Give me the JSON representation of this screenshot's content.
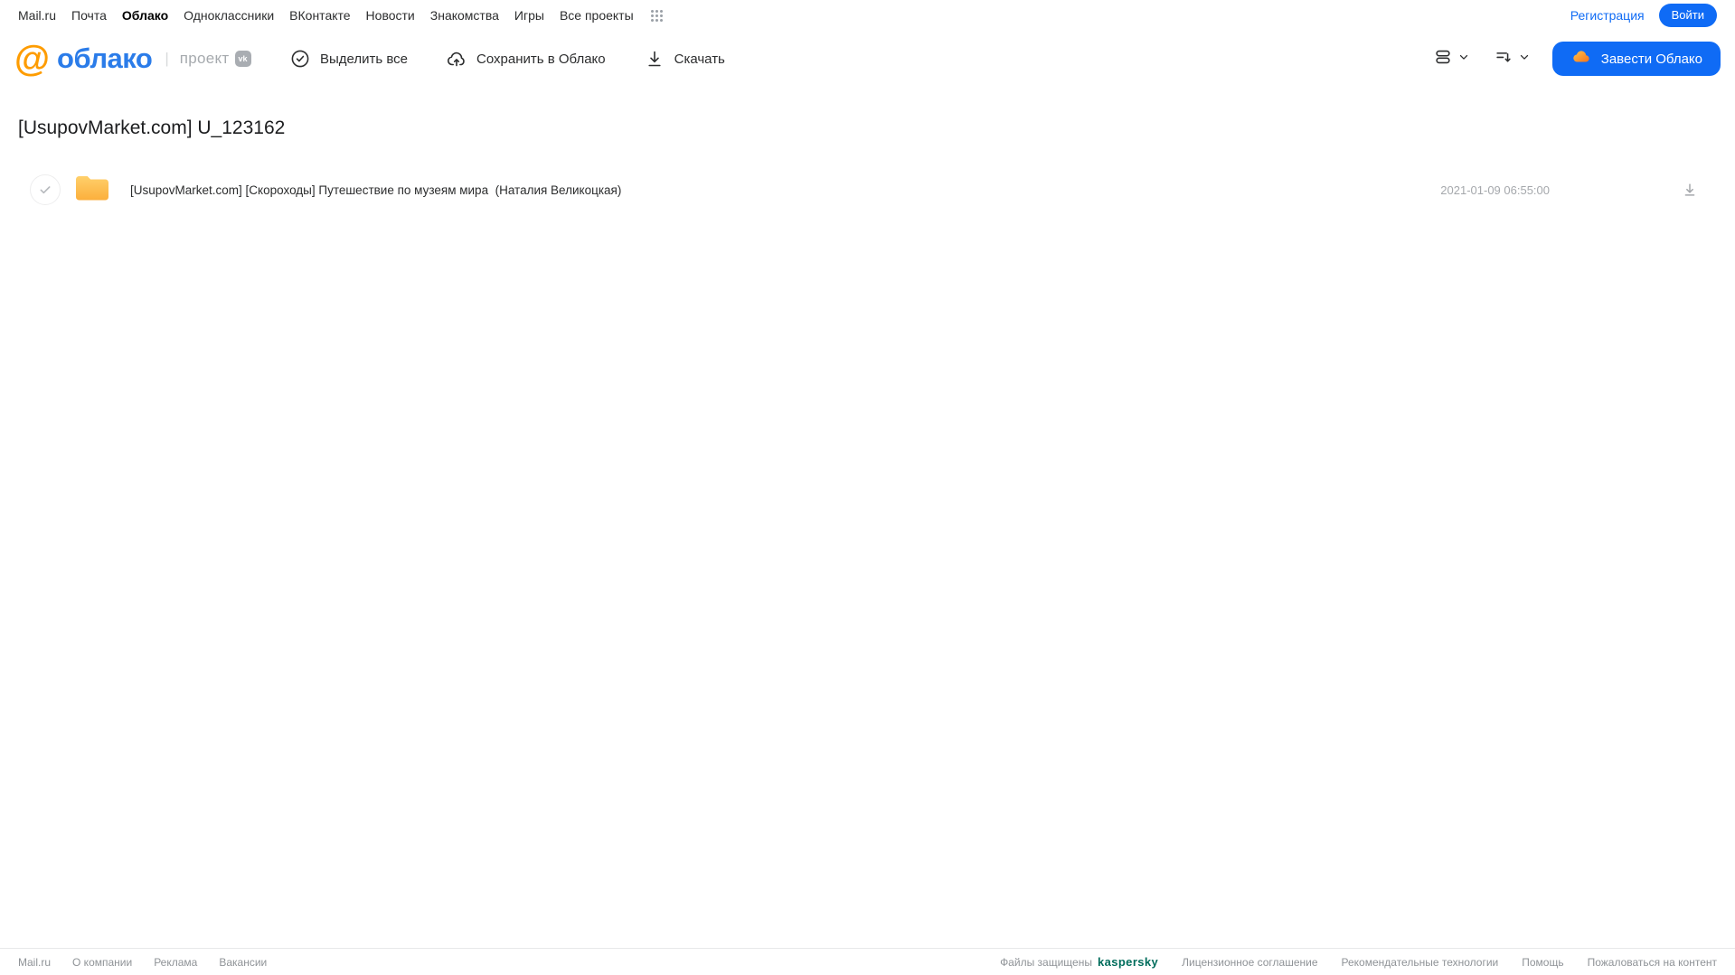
{
  "topnav": {
    "items": [
      "Mail.ru",
      "Почта",
      "Облако",
      "Одноклассники",
      "ВКонтакте",
      "Новости",
      "Знакомства",
      "Игры",
      "Все проекты"
    ],
    "active_item": "Облако",
    "register_label": "Регистрация",
    "login_label": "Войти"
  },
  "header": {
    "logo_at": "@",
    "logo_text": "облако",
    "project_label": "проект",
    "vk_badge": "vk",
    "toolbar": {
      "select_all_label": "Выделить все",
      "save_to_cloud_label": "Сохранить в Облако",
      "download_label": "Скачать"
    },
    "get_cloud_label": "Завести Облако"
  },
  "main": {
    "title": "[UsupovMarket.com] U_123162",
    "files": [
      {
        "type": "folder",
        "name": "[UsupovMarket.com] [Скороходы] Путешествие по музеям мира  (Наталия Великоцкая)",
        "date": "2021-01-09 06:55:00"
      }
    ]
  },
  "footer": {
    "left_links": [
      "Mail.ru",
      "О компании",
      "Реклама",
      "Вакансии"
    ],
    "protected_label": "Файлы защищены",
    "kaspersky_label": "kaspersky",
    "right_links": [
      "Лицензионное соглашение",
      "Рекомендательные технологии",
      "Помощь",
      "Пожаловаться на контент"
    ]
  },
  "colors": {
    "accent_blue": "#0f6bf5",
    "logo_blue": "#2b7ce9",
    "logo_orange": "#fe9c00",
    "folder_yellow_top": "#ffd06b",
    "folder_yellow_bottom": "#fbaf3c",
    "kaspersky_teal": "#006d5c",
    "muted_gray": "#a5a8ac"
  }
}
